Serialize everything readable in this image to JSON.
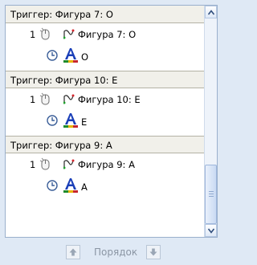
{
  "groups": [
    {
      "trigger": "Триггер: Фигура 7: O",
      "order": "1",
      "shape": "Фигура 7: O",
      "letter": "O"
    },
    {
      "trigger": "Триггер: Фигура 10: E",
      "order": "1",
      "shape": "Фигура 10: E",
      "letter": "E"
    },
    {
      "trigger": "Триггер: Фигура 9: A",
      "order": "1",
      "shape": "Фигура 9: A",
      "letter": "A"
    }
  ],
  "footer": {
    "order_label": "Порядок"
  },
  "icons": {
    "mouse": "mouse-click-icon",
    "motion": "motion-path-icon",
    "clock": "clock-icon",
    "text_effect": "text-effect-icon",
    "up": "move-up-icon",
    "down": "move-down-icon"
  },
  "colors": {
    "panel_bg": "#dfe9f5",
    "trigger_bg": "#f1f0ea",
    "accent_blue": "#1a3fb8"
  }
}
